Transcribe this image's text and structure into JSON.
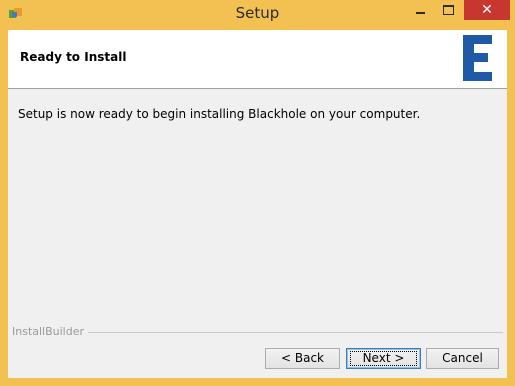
{
  "window": {
    "title": "Setup",
    "icon": "installer-app-icon",
    "controls": {
      "minimize": "minimize-icon",
      "maximize": "maximize-icon",
      "close": "✕"
    }
  },
  "header": {
    "title": "Ready to Install",
    "logo": "brand-logo-icon",
    "logo_color": "#1f5aa6"
  },
  "body": {
    "message": "Setup is now ready to begin installing Blackhole on your computer."
  },
  "footer": {
    "brand": "InstallBuilder",
    "back_label": "< Back",
    "next_label": "Next >",
    "cancel_label": "Cancel"
  },
  "colors": {
    "frame": "#f3c152",
    "close_button": "#c7372f",
    "client_background": "#f0f0f0"
  }
}
